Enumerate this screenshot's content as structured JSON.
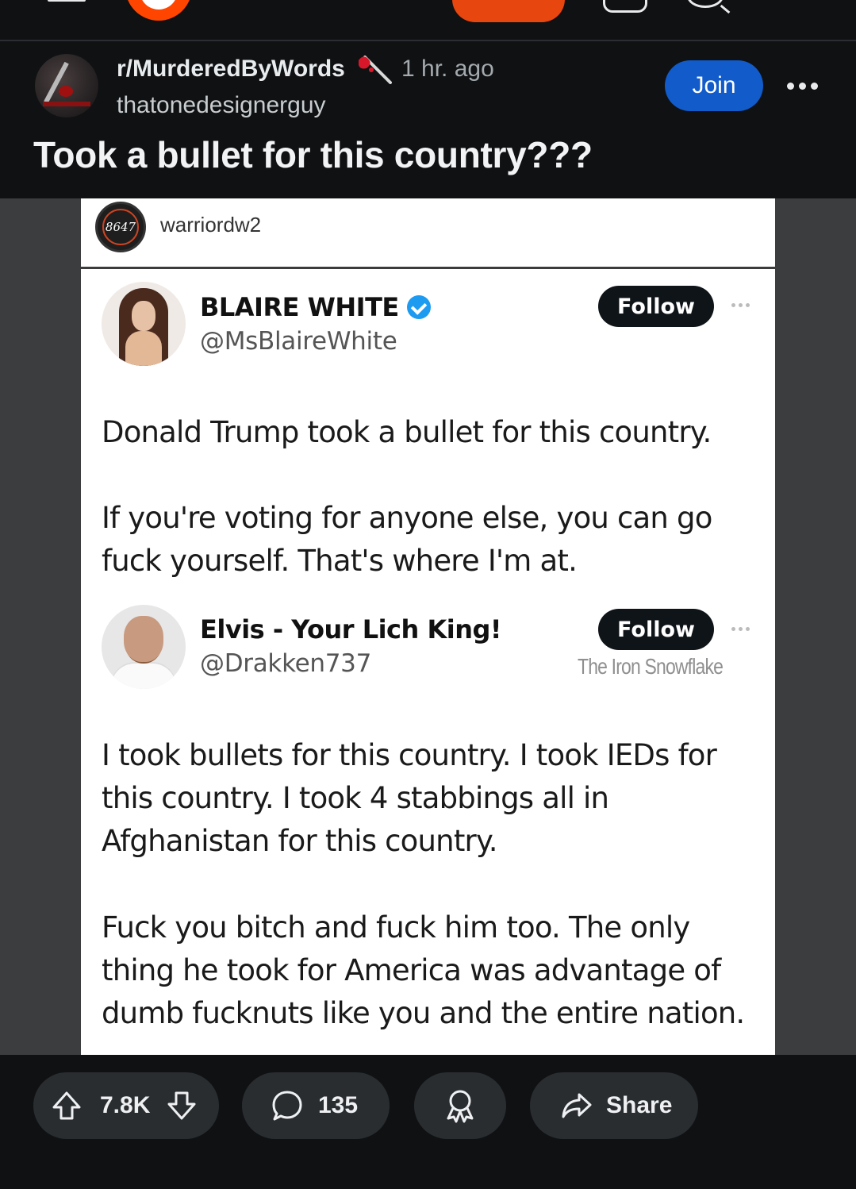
{
  "post": {
    "subreddit": "r/MurderedByWords",
    "time": "1 hr. ago",
    "author": "thatonedesignerguy",
    "title": "Took a bullet for this country???",
    "join_label": "Join"
  },
  "image": {
    "ig_user": "warriordw2",
    "ig_avatar_text": "8647",
    "tweet1": {
      "name": "BLAIRE WHITE",
      "handle": "@MsBlaireWhite",
      "follow_label": "Follow",
      "paragraph1": "Donald Trump took a bullet for this country.",
      "paragraph2_line1": "If you're voting for anyone else, you can go",
      "paragraph2_line2": "fuck yourself. That's where I'm at."
    },
    "tweet2": {
      "name": "Elvis - Your Lich King!",
      "handle": "@Drakken737",
      "follow_label": "Follow",
      "watermark": "The Iron Snowflake",
      "paragraph1_line1": "I took bullets for this country. I took IEDs for",
      "paragraph1_line2": "this country. I took 4 stabbings all in",
      "paragraph1_line3": "Afghanistan for this country.",
      "paragraph2_line1": "Fuck you bitch and fuck him too. The only",
      "paragraph2_line2": "thing he took for America was advantage of",
      "paragraph2_line3": "dumb fucknuts like you and the entire nation."
    }
  },
  "actions": {
    "votes": "7.8K",
    "comments": "135",
    "share_label": "Share"
  },
  "colors": {
    "background": "#0f1113",
    "join_blue": "#115bca",
    "brand_orange": "#ff4500",
    "pill_gray": "#2a2d30"
  }
}
